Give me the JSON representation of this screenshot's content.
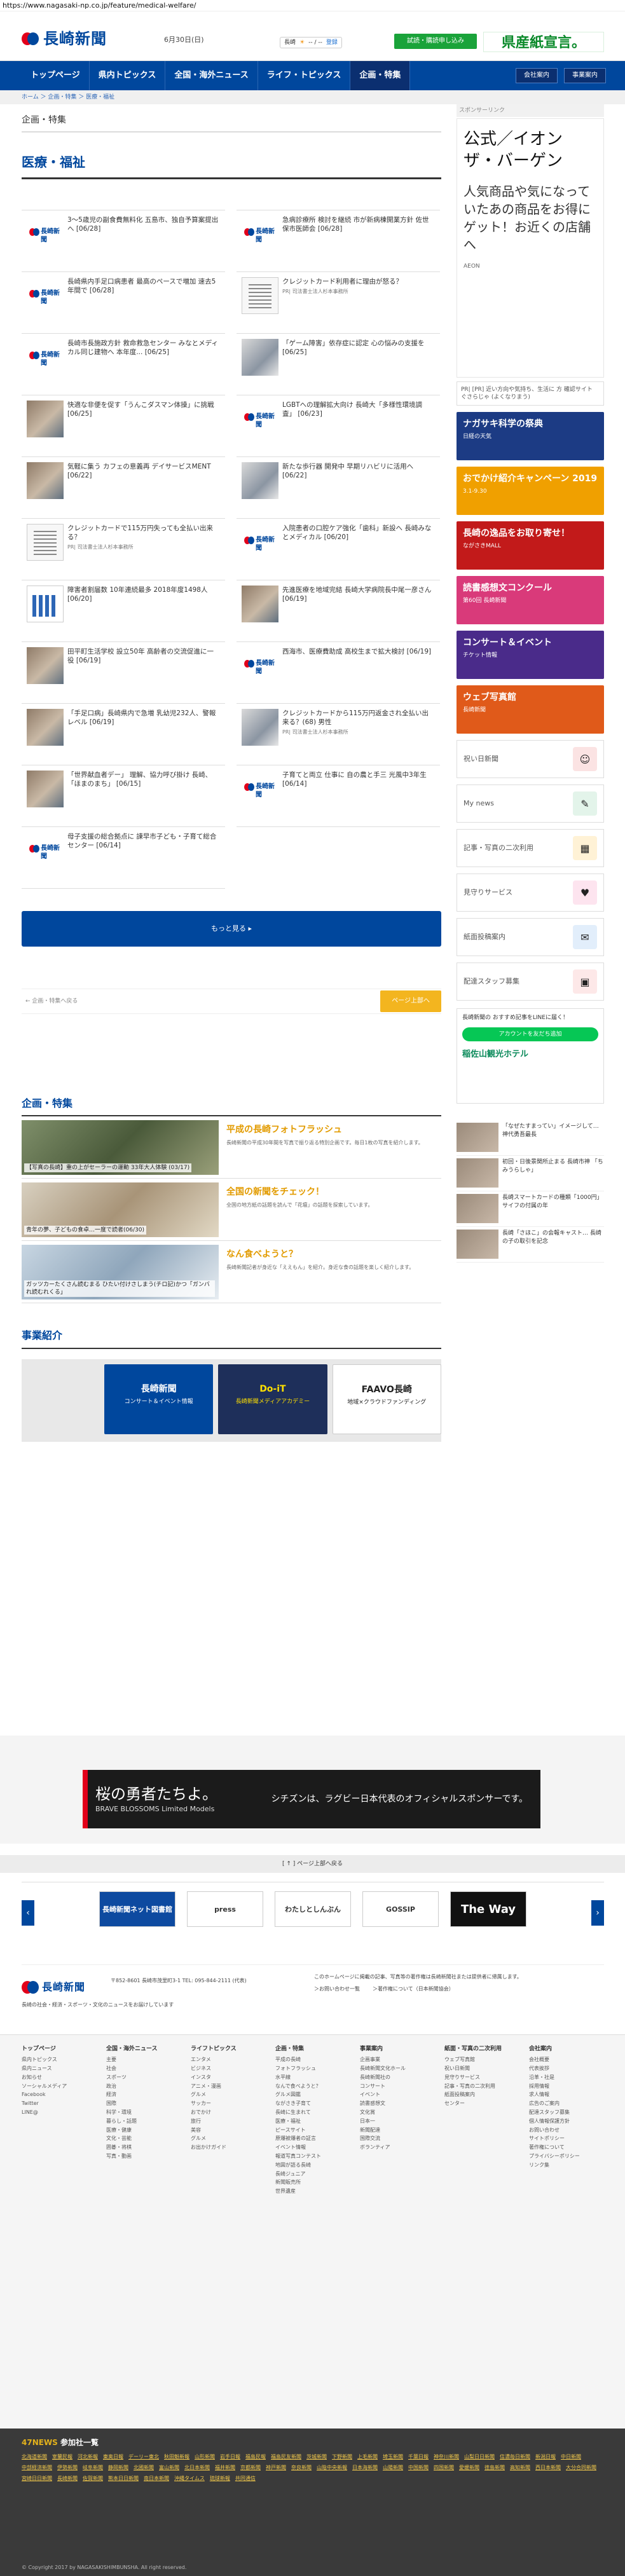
{
  "url": "https://www.nagasaki-np.co.jp/feature/medical-welfare/",
  "header": {
    "logo_text": "長崎新聞",
    "date": "6月30日(日)",
    "weather_city": "長崎",
    "weather_temp": "-- / --",
    "weather_link": "登録",
    "trial_label": "試読・購読申し込み",
    "ad_text": "県産紙宣言。"
  },
  "nav": {
    "items": [
      "トップページ",
      "県内トピックス",
      "全国・海外ニュース",
      "ライフ・トピックス",
      "企画・特集"
    ],
    "right": [
      "会社案内",
      "事業案内"
    ]
  },
  "breadcrumb": "ホーム ＞ 企画・特集 ＞ 医療・福祉",
  "main": {
    "kicker": "企画・特集",
    "section_title": "医療・福祉",
    "articles": [
      {
        "title": "3～5歳児の副食費無料化 五島市、独自予算案提出へ [06/28]",
        "sub": "",
        "thumb": "logo"
      },
      {
        "title": "急病診療所 検討を継続 市が新病棟開業方針 佐世保市医師会 [06/28]",
        "sub": "",
        "thumb": "logo"
      },
      {
        "title": "長崎県内手足口病患者 最高のペースで増加 速去5年間で [06/28]",
        "sub": "",
        "thumb": "logo"
      },
      {
        "title": "クレジットカード利用者に理由が怒る？",
        "sub": "PR| 司法書士法人杉本事務所",
        "thumb": "doc"
      },
      {
        "title": "長崎市長施政方針 救命救急センター みなとメディカル同じ建物へ 本年度... [06/25]",
        "sub": "",
        "thumb": "logo"
      },
      {
        "title": "「ゲーム障害」依存症に認定 心の悩みの支援を [06/25]",
        "sub": "",
        "thumb": "photo2"
      },
      {
        "title": "快適な非便を促す「うんこダスマン体操」に挑戦 [06/25]",
        "sub": "",
        "thumb": "photo"
      },
      {
        "title": "LGBTへの理解拡大向け 長崎大「多様性環境調査」 [06/23]",
        "sub": "",
        "thumb": "logo"
      },
      {
        "title": "気軽に集う カフェの意義再 デイサービスMENT [06/22]",
        "sub": "",
        "thumb": "photo"
      },
      {
        "title": "新たな歩行器 開発中 早期リハビリに活用へ [06/22]",
        "sub": "",
        "thumb": "photo2"
      },
      {
        "title": "クレジットカードで115万円失っても全払い出来る？",
        "sub": "PR| 司法書士法人杉本事務所",
        "thumb": "doc"
      },
      {
        "title": "入院患者の口腔ケア強化「歯科」新設へ 長崎みなとメディカル [06/20]",
        "sub": "",
        "thumb": "logo"
      },
      {
        "title": "障害者割届数 10年連続最多 2018年度1498人 [06/20]",
        "sub": "",
        "thumb": "chart"
      },
      {
        "title": "先進医療を地域完結 長崎大学病院長中尾一彦さん [06/19]",
        "sub": "",
        "thumb": "photo"
      },
      {
        "title": "田平町生活学校 設立50年 高齢者の交流促進に一役 [06/19]",
        "sub": "",
        "thumb": "photo"
      },
      {
        "title": "西海市、医療費助成 高校生まで拡大検討 [06/19]",
        "sub": "",
        "thumb": "logo"
      },
      {
        "title": "「手足口病」長崎県内で急増 乳幼児232人、警報レベル [06/19]",
        "sub": "",
        "thumb": "photo"
      },
      {
        "title": "クレジットカードから115万円返金され全払い出来る？(68) 男性",
        "sub": "PR| 司法書士法人杉本事務所",
        "thumb": "photo2"
      },
      {
        "title": "「世界献血者デー」 理解、協力呼び掛け 長崎、「ほまのまち」 [06/15]",
        "sub": "",
        "thumb": "photo"
      },
      {
        "title": "子育てと両立 仕事に 自の農と手三 光風中3年生 [06/14]",
        "sub": "",
        "thumb": "logo"
      },
      {
        "title": "母子支援の総合拠点に 諫早市子ども・子育て総合センター [06/14]",
        "sub": "",
        "thumb": "logo"
      }
    ],
    "more_label": "もっと見る ▸",
    "pager_back": "← 企画・特集へ戻る",
    "pager_next": "ページ上部へ",
    "feature_section_title": "企画・特集",
    "features": [
      {
        "cap": "【写真の長崎】重の上がセーラーの運動 33年大人体験 (03/17)",
        "heading": "平成の長崎フォトフラッシュ",
        "text": "長崎新聞の平成30年間を写真で振り返る特別企画です。毎日1枚の写真を紹介します。"
      },
      {
        "cap": "青年の夢、子どもの食卓…一度で読者(06/30)",
        "heading": "全国の新聞をチェック！",
        "text": "全国の地方紙の話題を読んで「花壇」の話題を探索しています。"
      },
      {
        "cap": "ガッツカーたくさん読むまる ひたい付けさしまう(チロ記)かつ「ガンバれ読むれくる」",
        "heading": "なん食べようと？",
        "text": "長崎新聞記者が身近な「ええもん」を紹介。身近な食の話題を楽しく紹介します。"
      }
    ],
    "biz_title": "事業紹介",
    "slides": [
      {
        "title": "長崎新聞",
        "sub": "コンサート＆イベント情報"
      },
      {
        "title": "Do-iT",
        "sub": "長崎新聞メディアアカデミー"
      },
      {
        "title": "FAAVO長崎",
        "sub": "地域×クラウドファンディング"
      }
    ]
  },
  "side": {
    "sponsor_label": "スポンサーリンク",
    "ad_heading": "公式／イオン ザ・バーゲン",
    "ad_body": "人気商品や気になっていたあの商品をお得にゲット！お近くの店舗へ",
    "ad_brand": "AEON",
    "ad_foot": "PR| [PR] 近い方向や気持ち、生活に 方 確認サイト ぐさらじゃ (よくなりまう)",
    "banners": [
      {
        "title": "ナガサキ科学の祭典",
        "sub": "日経の天気",
        "color": "#1c3b84"
      },
      {
        "title": "おでかけ紹介キャンペーン 2019",
        "sub": "3.1-9.30",
        "color": "#f0a000"
      },
      {
        "title": "長崎の逸品をお取り寄せ！",
        "sub": "ながさきMALL",
        "color": "#c21a1a"
      },
      {
        "title": "読書感想文コンクール",
        "sub": "第60回 長崎新聞",
        "color": "#d93a7a"
      },
      {
        "title": "コンサート＆イベント",
        "sub": "チケット情報",
        "color": "#4a2b8a"
      },
      {
        "title": "ウェブ写真館",
        "sub": "長崎新聞",
        "color": "#e05a1a"
      }
    ],
    "menus": [
      {
        "label": "祝い日新聞",
        "icon": "☺",
        "bg": "#fbe3e3"
      },
      {
        "label": "My news",
        "icon": "✎",
        "bg": "#e3f4ea"
      },
      {
        "label": "記事・写真の二次利用",
        "icon": "▦",
        "bg": "#fff2d6"
      },
      {
        "label": "見守りサービス",
        "icon": "♥",
        "bg": "#fde4ef"
      },
      {
        "label": "紙面投稿案内",
        "icon": "✉",
        "bg": "#e2eefb"
      },
      {
        "label": "配達スタッフ募集",
        "icon": "▣",
        "bg": "#fde8e8"
      }
    ],
    "line_title": "長崎新聞の おすすめ記事をLINEに届く！",
    "line_btn": "アカウントを友だち追加",
    "hotel": "稲佐山観光ホテル",
    "side_news": [
      "「なぜたすまってい」イメージして…神代勇吾最長",
      "初回・日後景関所止まる 長崎市神 「ちみうらしゃ」",
      "長崎スマートカードの種類「1000円」 サイフの付属の年",
      "長崎「さほこ」の会報キャスト… 長崎の子の取引を記念"
    ]
  },
  "bottom_ad": {
    "headline": "桜の勇者たちよ。",
    "sub": "BRAVE BLOSSOMS Limited Models",
    "right": "シチズンは、ラグビー日本代表のオフィシャルスポンサーです。"
  },
  "top_link": "[ ↑ ] ページ上部へ戻る",
  "strip": [
    "長崎新聞ネット図書館",
    "press",
    "わたしとしんぶん",
    "GOSSIP",
    "The Way"
  ],
  "footer": {
    "logo": "長崎新聞",
    "address": "〒852-8601 長崎市茂里町3-1\nTEL: 095-844-2111 (代表)",
    "note": "長崎の社会・経済・スポーツ・文化のニュースをお届けしています",
    "right": "このホームページに掲載の記事、写真等の著作権は長崎新聞社または提供者に帰属します。",
    "links_left": "＞お問い合わせ一覧",
    "links_right": "＞著作権について（日本新聞協会）"
  },
  "footer_cols": [
    {
      "h": "トップページ",
      "items": [
        "県内トピックス",
        "県内ニュース",
        "お知らせ",
        "ソーシャルメディア",
        "Facebook",
        "Twitter",
        "LINE@"
      ]
    },
    {
      "h": "全国・海外ニュース",
      "items": [
        "主要",
        "社会",
        "スポーツ",
        "政治",
        "経済",
        "国際",
        "科学・環境",
        "暮らし・話題",
        "医療・健康",
        "文化・芸能",
        "囲碁・将棋",
        "写真・動画"
      ]
    },
    {
      "h": "ライフトピックス",
      "items": [
        "エンタメ",
        "ビジネス",
        "インスタ",
        "アニメ・漫画",
        "グルメ",
        "サッカー",
        "おでかけ",
        "旅行",
        "美容",
        "グルメ",
        "お出かけガイド"
      ]
    },
    {
      "h": "企画・特集",
      "items": [
        "平成の長崎",
        "フォトフラッシュ",
        "水平線",
        "なんで食べようと？",
        "グルメ図鑑",
        "ながさき子育て",
        "長崎に生まれて",
        "医療・福祉",
        "ピースサイト",
        "原爆被爆者の証言",
        "イベント情報",
        "報道写真コンテスト",
        "地図が語る長崎",
        "長崎ジュニア",
        "新聞販売所",
        "世界遺産"
      ]
    },
    {
      "h": "事業案内",
      "items": [
        "企画事業",
        "長崎新聞文化ホール",
        "長崎新聞社の",
        "コンサート",
        "イベント",
        "読書感想文",
        "文化賞",
        "日本一",
        "新聞配達",
        "国際交流",
        "ボランティア"
      ]
    },
    {
      "h": "紙面・写真の二次利用",
      "items": [
        "ウェブ写真館",
        "祝い日新聞",
        "見守りサービス",
        "記事・写真の二次利用",
        "紙面投稿案内",
        "センター"
      ]
    },
    {
      "h": "会社案内",
      "items": [
        "会社概要",
        "代表挨拶",
        "沿革・社是",
        "採用情報",
        "求人情報",
        "広告のご案内",
        "配達スタッフ募集",
        "個人情報保護方針",
        "お問い合わせ",
        "サイトポリシー",
        "著作権について",
        "プライバシーポリシー",
        "リンク集"
      ]
    }
  ],
  "n47": {
    "title": "47NEWS",
    "title_suffix": "参加社一覧",
    "items": [
      "北海道新聞",
      "室蘭民報",
      "河北新報",
      "東奥日報",
      "デーリー東北",
      "秋田魁新報",
      "山形新聞",
      "岩手日報",
      "福島民報",
      "福島民友新聞",
      "茨城新聞",
      "下野新聞",
      "上毛新聞",
      "埼玉新聞",
      "千葉日報",
      "神奈川新聞",
      "山梨日日新聞",
      "信濃毎日新聞",
      "新潟日報",
      "中日新聞",
      "中部経済新聞",
      "伊勢新聞",
      "岐阜新聞",
      "静岡新聞",
      "北國新聞",
      "富山新聞",
      "北日本新聞",
      "福井新聞",
      "京都新聞",
      "神戸新聞",
      "奈良新聞",
      "山陰中央新報",
      "日本海新聞",
      "山陽新聞",
      "中国新聞",
      "四国新聞",
      "愛媛新聞",
      "徳島新聞",
      "高知新聞",
      "西日本新聞",
      "大分合同新聞",
      "宮崎日日新聞",
      "長崎新聞",
      "佐賀新聞",
      "熊本日日新聞",
      "南日本新聞",
      "沖縄タイムス",
      "琉球新報",
      "共同通信"
    ]
  },
  "copyright": "© Copyright 2017 by NAGASAKISHIMBUNSHA. All right reserved."
}
